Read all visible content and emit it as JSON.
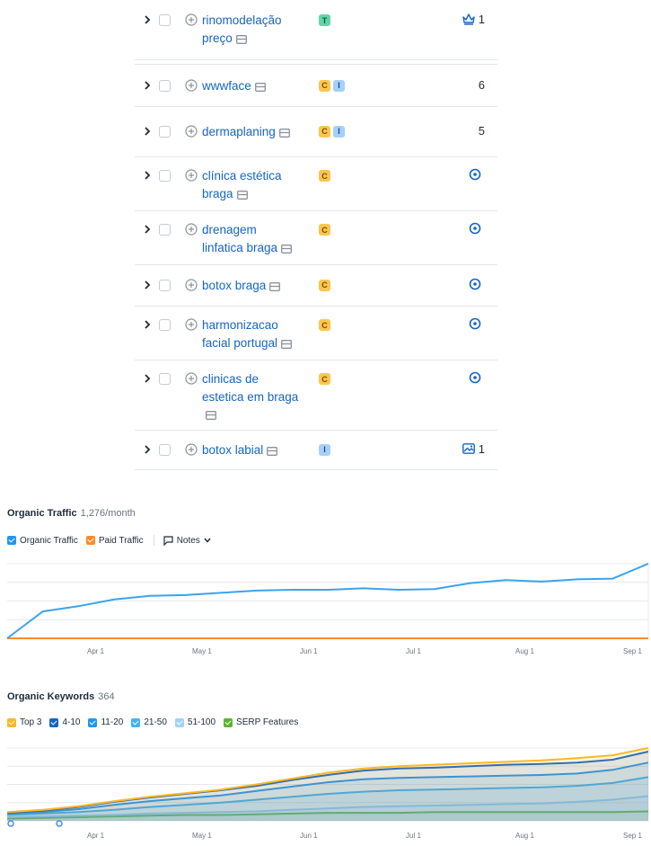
{
  "keywords": [
    {
      "keyword": "rinomodelação preço",
      "intents": [
        "T"
      ],
      "position_icon": "crown-icon",
      "position": "1"
    },
    {
      "keyword": "wwwface",
      "intents": [
        "C",
        "I"
      ],
      "position_icon": "",
      "position": "6"
    },
    {
      "keyword": "dermaplaning",
      "intents": [
        "C",
        "I"
      ],
      "position_icon": "",
      "position": "5"
    },
    {
      "keyword": "clínica estética braga",
      "intents": [
        "C"
      ],
      "position_icon": "location-pin-icon",
      "position": ""
    },
    {
      "keyword": "drenagem linfatica braga",
      "intents": [
        "C"
      ],
      "position_icon": "location-pin-icon",
      "position": ""
    },
    {
      "keyword": "botox braga",
      "intents": [
        "C"
      ],
      "position_icon": "location-pin-icon",
      "position": ""
    },
    {
      "keyword": "harmonizacao facial portugal",
      "intents": [
        "C"
      ],
      "position_icon": "location-pin-icon",
      "position": ""
    },
    {
      "keyword": "clinicas de estetica em braga",
      "intents": [
        "C"
      ],
      "position_icon": "location-pin-icon",
      "position": ""
    },
    {
      "keyword": "botox labial",
      "intents": [
        "I"
      ],
      "position_icon": "image-icon",
      "position": "1"
    }
  ],
  "organic_traffic": {
    "title": "Organic Traffic",
    "value": "1,276/month",
    "legend": [
      {
        "label": "Organic Traffic",
        "color": "#2196f3"
      },
      {
        "label": "Paid Traffic",
        "color": "#ff8c26"
      }
    ],
    "notes_label": "Notes"
  },
  "organic_keywords": {
    "title": "Organic Keywords",
    "value": "364",
    "legend": [
      {
        "label": "Top 3",
        "color": "#fcb825"
      },
      {
        "label": "4-10",
        "color": "#1565c0"
      },
      {
        "label": "11-20",
        "color": "#2196f3"
      },
      {
        "label": "21-50",
        "color": "#40b4f5"
      },
      {
        "label": "51-100",
        "color": "#9fd3f7"
      },
      {
        "label": "SERP Features",
        "color": "#5cb531"
      }
    ]
  },
  "chart_data": [
    {
      "type": "line",
      "title": "Organic Traffic",
      "x_ticks": [
        "Apr 1",
        "May 1",
        "Jun 1",
        "Jul 1",
        "Aug 1",
        "Sep 1"
      ],
      "x": [
        0,
        10,
        20,
        30,
        40,
        50,
        60,
        70,
        80,
        90,
        100,
        110,
        120,
        130,
        140,
        150,
        160,
        170,
        180
      ],
      "series": [
        {
          "name": "Organic Traffic",
          "color": "#3ba3ee",
          "values": [
            0,
            36,
            43,
            52,
            57,
            58,
            61,
            64,
            65,
            65,
            67,
            65,
            66,
            74,
            78,
            76,
            79,
            80,
            100
          ]
        },
        {
          "name": "Paid Traffic",
          "color": "#ff8c26",
          "values": [
            0,
            0,
            0,
            0,
            0,
            0,
            0,
            0,
            0,
            0,
            0,
            0,
            0,
            0,
            0,
            0,
            0,
            0,
            0
          ]
        }
      ],
      "ylim": [
        0,
        100
      ],
      "grid": true
    },
    {
      "type": "area",
      "title": "Organic Keywords",
      "x_ticks": [
        "Apr 1",
        "May 1",
        "Jun 1",
        "Jul 1",
        "Aug 1",
        "Sep 1"
      ],
      "x": [
        0,
        10,
        20,
        30,
        40,
        50,
        60,
        70,
        80,
        90,
        100,
        110,
        120,
        130,
        140,
        150,
        160,
        170,
        180
      ],
      "series": [
        {
          "name": "Top 3",
          "color": "#fcb825",
          "values": [
            0.12,
            0.15,
            0.2,
            0.27,
            0.33,
            0.38,
            0.43,
            0.5,
            0.58,
            0.66,
            0.72,
            0.75,
            0.77,
            0.79,
            0.81,
            0.83,
            0.86,
            0.9,
            1.0
          ]
        },
        {
          "name": "4-10",
          "color": "#1565c0",
          "values": [
            0.11,
            0.14,
            0.19,
            0.26,
            0.32,
            0.37,
            0.42,
            0.48,
            0.56,
            0.63,
            0.69,
            0.72,
            0.73,
            0.75,
            0.77,
            0.78,
            0.8,
            0.84,
            0.95
          ]
        },
        {
          "name": "11-20",
          "color": "#2196f3",
          "values": [
            0.1,
            0.12,
            0.16,
            0.22,
            0.27,
            0.31,
            0.35,
            0.41,
            0.47,
            0.53,
            0.57,
            0.59,
            0.6,
            0.61,
            0.62,
            0.63,
            0.65,
            0.7,
            0.8
          ]
        },
        {
          "name": "21-50",
          "color": "#40b4f5",
          "values": [
            0.08,
            0.1,
            0.12,
            0.15,
            0.19,
            0.22,
            0.25,
            0.29,
            0.33,
            0.37,
            0.4,
            0.42,
            0.43,
            0.44,
            0.45,
            0.46,
            0.48,
            0.52,
            0.6
          ]
        },
        {
          "name": "51-100",
          "color": "#9fd3f7",
          "values": [
            0.05,
            0.06,
            0.07,
            0.08,
            0.1,
            0.11,
            0.12,
            0.13,
            0.15,
            0.17,
            0.19,
            0.2,
            0.21,
            0.22,
            0.23,
            0.24,
            0.26,
            0.29,
            0.34
          ]
        },
        {
          "name": "SERP Features",
          "color": "#5cb531",
          "values": [
            0.03,
            0.04,
            0.05,
            0.06,
            0.07,
            0.08,
            0.08,
            0.09,
            0.1,
            0.11,
            0.11,
            0.11,
            0.12,
            0.12,
            0.12,
            0.12,
            0.12,
            0.12,
            0.13
          ]
        }
      ],
      "ylim": [
        0,
        1
      ],
      "grid": true
    }
  ]
}
